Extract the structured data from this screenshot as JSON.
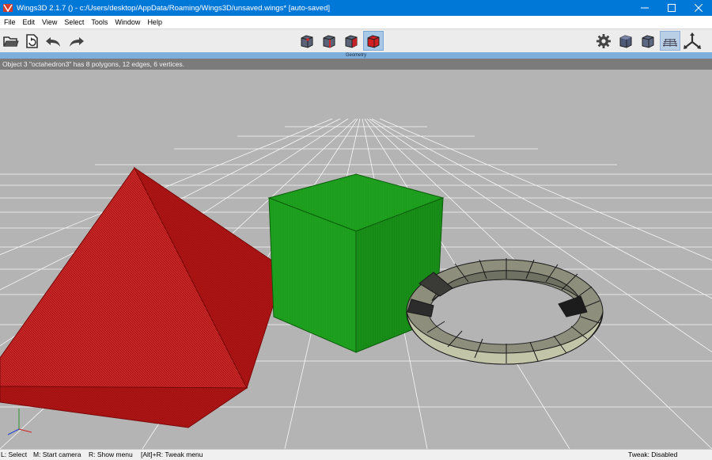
{
  "window": {
    "title": "Wings3D 2.1.7 () - c:/Users/desktop/AppData/Roaming/Wings3D/unsaved.wings* [auto-saved]",
    "controls": {
      "minimize": "–",
      "maximize": "☐",
      "close": "✕"
    }
  },
  "menu": [
    "File",
    "Edit",
    "View",
    "Select",
    "Tools",
    "Window",
    "Help"
  ],
  "toolbar": {
    "left_icons": [
      "open-folder-icon",
      "save-icon",
      "undo-icon",
      "redo-icon"
    ],
    "selection_modes": [
      "vertex-mode-icon",
      "edge-mode-icon",
      "face-mode-icon",
      "body-mode-icon"
    ],
    "active_mode": "body-mode-icon",
    "right_icons": [
      "gear-icon",
      "smooth-shaded-cube-icon",
      "wireframe-cube-icon",
      "ground-plane-icon",
      "axes-icon"
    ]
  },
  "viewport": {
    "label": "Geometry",
    "info": "Object 3 \"octahedron3\" has 8 polygons, 12 edges, 6 vertices.",
    "background_color": "#b4b4b4",
    "objects": [
      {
        "name": "octahedron",
        "color": "#b51818"
      },
      {
        "name": "cube",
        "color": "#1b9e1b"
      },
      {
        "name": "torus",
        "color": "#9a9c86"
      }
    ]
  },
  "status": {
    "left_click": "L: Select",
    "middle_click": "M: Start camera",
    "right_click": "R: Show menu",
    "alt_right": "[Alt]+R: Tweak menu",
    "tweak": "Tweak: Disabled"
  },
  "colors": {
    "titlebar": "#0078d7",
    "accent_strip": "#7eaedb",
    "infobar": "#7b7b7b",
    "active_mode": "#cc1c1c"
  }
}
